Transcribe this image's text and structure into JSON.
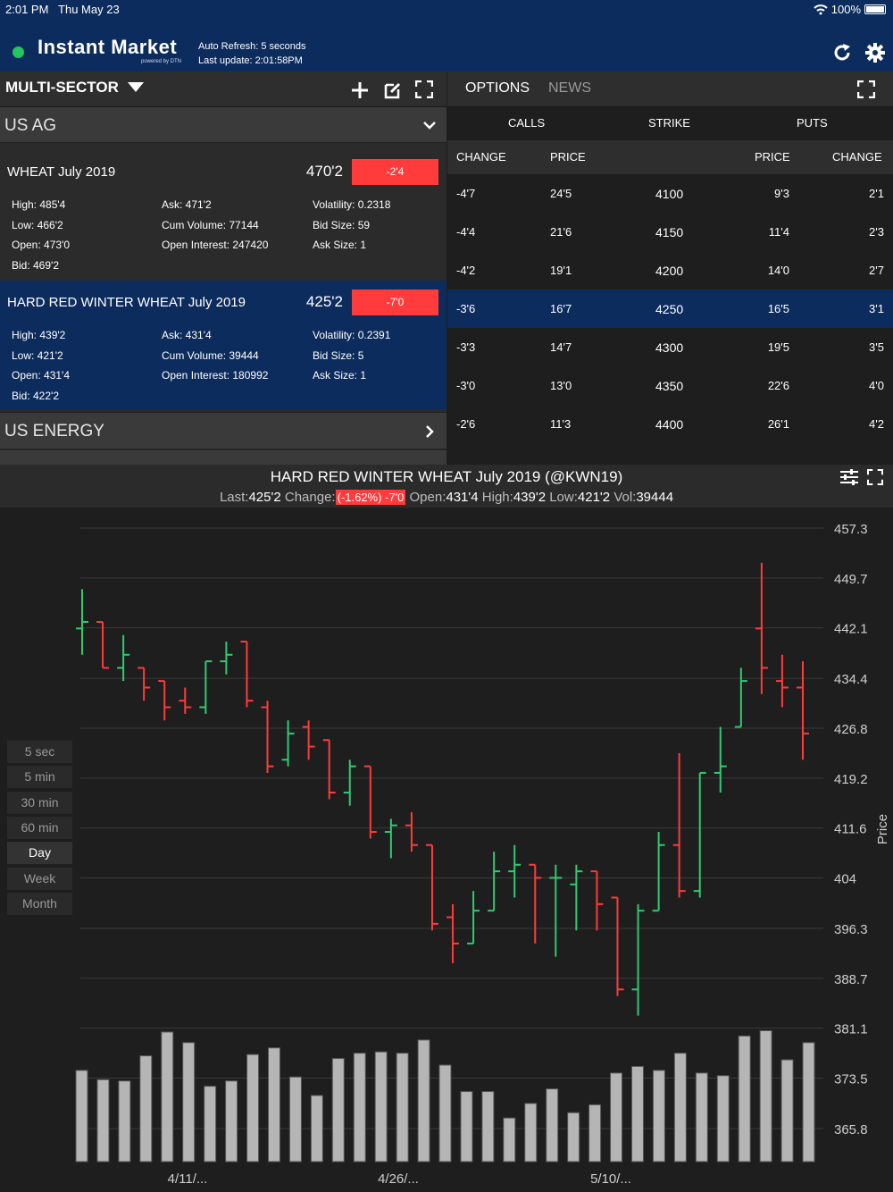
{
  "status": {
    "time": "2:01 PM",
    "date": "Thu May 23",
    "battery": "100%"
  },
  "header": {
    "brand": "Instant Market",
    "powered": "powered by DTN",
    "auto_refresh": "Auto Refresh: 5 seconds",
    "last_update": "Last update: 2:01:58PM"
  },
  "left": {
    "sector": "MULTI-SECTOR",
    "group1": "US AG",
    "group2": "US ENERGY",
    "cards": [
      {
        "title": "WHEAT July 2019",
        "price": "470'2",
        "change": "-2'4",
        "high": "High: 485'4",
        "low": "Low: 466'2",
        "open": "Open: 473'0",
        "bid": "Bid: 469'2",
        "ask": "Ask: 471'2",
        "cumvol": "Cum Volume: 77144",
        "oi": "Open Interest: 247420",
        "vol": "Volatility: 0.2318",
        "bidsize": "Bid Size: 59",
        "asksize": "Ask Size: 1"
      },
      {
        "title": "HARD RED WINTER WHEAT July 2019",
        "price": "425'2",
        "change": "-7'0",
        "high": "High: 439'2",
        "low": "Low: 421'2",
        "open": "Open: 431'4",
        "bid": "Bid: 422'2",
        "ask": "Ask: 431'4",
        "cumvol": "Cum Volume: 39444",
        "oi": "Open Interest: 180992",
        "vol": "Volatility: 0.2391",
        "bidsize": "Bid Size: 5",
        "asksize": "Ask Size: 1"
      }
    ]
  },
  "options": {
    "tabs": [
      "OPTIONS",
      "NEWS"
    ],
    "calls": "CALLS",
    "strike": "STRIKE",
    "puts": "PUTS",
    "cols": [
      "CHANGE",
      "PRICE",
      "PRICE",
      "CHANGE"
    ],
    "rows": [
      [
        "-4'7",
        "24'5",
        "4100",
        "9'3",
        "2'1"
      ],
      [
        "-4'4",
        "21'6",
        "4150",
        "11'4",
        "2'3"
      ],
      [
        "-4'2",
        "19'1",
        "4200",
        "14'0",
        "2'7"
      ],
      [
        "-3'6",
        "16'7",
        "4250",
        "16'5",
        "3'1"
      ],
      [
        "-3'3",
        "14'7",
        "4300",
        "19'5",
        "3'5"
      ],
      [
        "-3'0",
        "13'0",
        "4350",
        "22'6",
        "4'0"
      ],
      [
        "-2'6",
        "11'3",
        "4400",
        "26'1",
        "4'2"
      ]
    ],
    "selected_row": 3
  },
  "chart": {
    "title": "HARD RED WINTER WHEAT July 2019  (@KWN19)",
    "last_label": "Last:",
    "last": "425'2",
    "change_label": "Change:",
    "change": "(-1.62%) -7'0",
    "open_label": "Open:",
    "open": "431'4",
    "high_label": "High:",
    "high": "439'2",
    "low_label": "Low:",
    "low": "421'2",
    "vol_label": "Vol:",
    "vol": "39444",
    "timeframes": [
      "5 sec",
      "5 min",
      "30 min",
      "60 min",
      "Day",
      "Week",
      "Month"
    ],
    "active_timeframe": 4,
    "colors": {
      "up": "#2ecc71",
      "down": "#ff3b3b",
      "volume": "#b5b5b5"
    }
  },
  "chart_data": {
    "type": "ohlc",
    "ylabel": "Price",
    "yticks": [
      457.3,
      449.7,
      442.1,
      434.4,
      426.8,
      419.2,
      411.6,
      404.0,
      396.3,
      388.7,
      381.1,
      373.5,
      365.8
    ],
    "xticks": [
      "4/11/...",
      "4/26/...",
      "5/10/..."
    ],
    "grid": true,
    "bars": [
      {
        "o": 442,
        "h": 448,
        "l": 438,
        "c": 443
      },
      {
        "o": 443,
        "h": 443,
        "l": 436,
        "c": 436
      },
      {
        "o": 436,
        "h": 441,
        "l": 434,
        "c": 438
      },
      {
        "o": 436,
        "h": 436,
        "l": 431,
        "c": 433
      },
      {
        "o": 434,
        "h": 434,
        "l": 428,
        "c": 430
      },
      {
        "o": 431,
        "h": 433,
        "l": 429,
        "c": 430
      },
      {
        "o": 430,
        "h": 437,
        "l": 429,
        "c": 437
      },
      {
        "o": 437,
        "h": 440,
        "l": 435,
        "c": 438
      },
      {
        "o": 440,
        "h": 440,
        "l": 430,
        "c": 431
      },
      {
        "o": 430,
        "h": 431,
        "l": 420,
        "c": 421
      },
      {
        "o": 422,
        "h": 428,
        "l": 421,
        "c": 426
      },
      {
        "o": 427,
        "h": 428,
        "l": 422,
        "c": 424
      },
      {
        "o": 425,
        "h": 425,
        "l": 416,
        "c": 417
      },
      {
        "o": 417,
        "h": 422,
        "l": 415,
        "c": 421
      },
      {
        "o": 421,
        "h": 421,
        "l": 410,
        "c": 411
      },
      {
        "o": 411,
        "h": 413,
        "l": 407,
        "c": 412
      },
      {
        "o": 412,
        "h": 414,
        "l": 408,
        "c": 409
      },
      {
        "o": 409,
        "h": 409,
        "l": 396,
        "c": 397
      },
      {
        "o": 398,
        "h": 400,
        "l": 391,
        "c": 394
      },
      {
        "o": 394,
        "h": 402,
        "l": 394,
        "c": 399
      },
      {
        "o": 399,
        "h": 408,
        "l": 399,
        "c": 405
      },
      {
        "o": 405,
        "h": 409,
        "l": 401,
        "c": 406
      },
      {
        "o": 406,
        "h": 406,
        "l": 394,
        "c": 404
      },
      {
        "o": 404,
        "h": 406,
        "l": 392,
        "c": 404
      },
      {
        "o": 403,
        "h": 406,
        "l": 396,
        "c": 405
      },
      {
        "o": 405,
        "h": 405,
        "l": 396,
        "c": 400
      },
      {
        "o": 401,
        "h": 401,
        "l": 386,
        "c": 387
      },
      {
        "o": 387,
        "h": 400,
        "l": 383,
        "c": 399
      },
      {
        "o": 399,
        "h": 411,
        "l": 399,
        "c": 409
      },
      {
        "o": 409,
        "h": 423,
        "l": 401,
        "c": 402
      },
      {
        "o": 402,
        "h": 420,
        "l": 401,
        "c": 420
      },
      {
        "o": 420,
        "h": 427,
        "l": 417,
        "c": 421
      },
      {
        "o": 427,
        "h": 436,
        "l": 427,
        "c": 434
      },
      {
        "o": 442,
        "h": 452,
        "l": 432,
        "c": 436
      },
      {
        "o": 434,
        "h": 438,
        "l": 430,
        "c": 433
      },
      {
        "o": 433,
        "h": 437,
        "l": 422,
        "c": 426
      }
    ],
    "volume": [
      0.69,
      0.62,
      0.61,
      0.8,
      0.98,
      0.9,
      0.57,
      0.61,
      0.81,
      0.86,
      0.64,
      0.5,
      0.78,
      0.82,
      0.83,
      0.82,
      0.92,
      0.73,
      0.53,
      0.53,
      0.33,
      0.44,
      0.55,
      0.37,
      0.43,
      0.67,
      0.72,
      0.69,
      0.82,
      0.67,
      0.65,
      0.95,
      0.99,
      0.77,
      0.9
    ]
  }
}
